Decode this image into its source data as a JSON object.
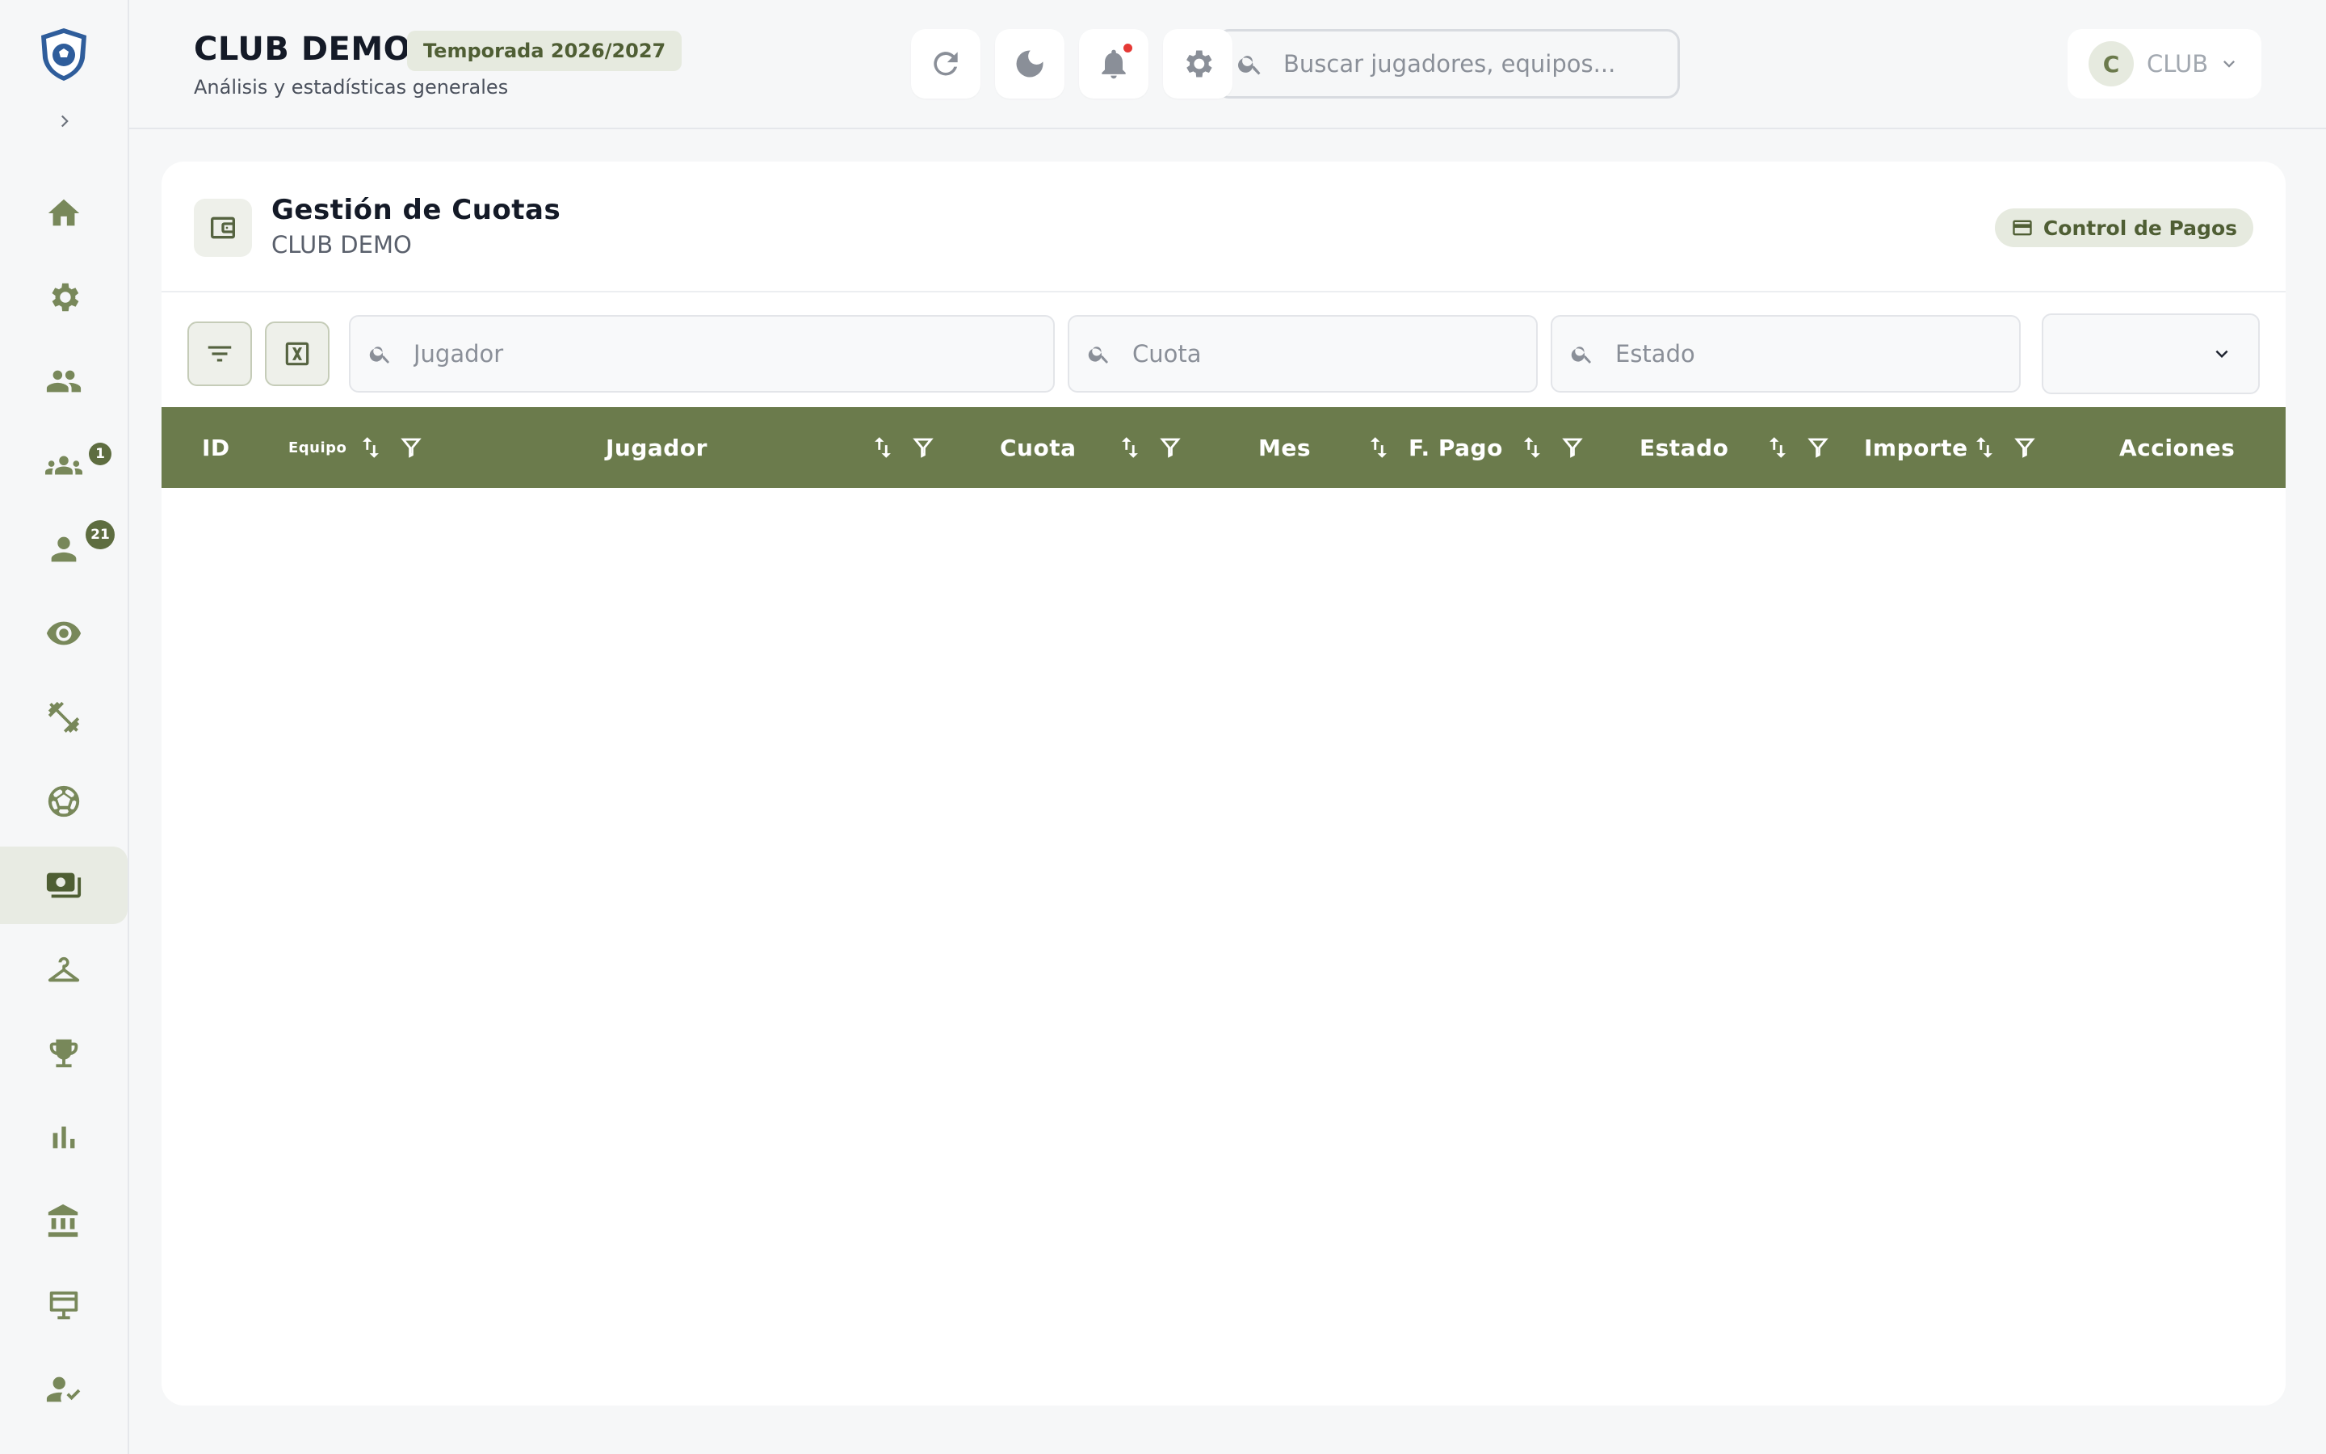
{
  "header": {
    "club_title": "CLUB DEMO",
    "season": "Temporada 2026/2027",
    "subtitle": "Análisis y estadísticas generales",
    "search_placeholder": "Buscar jugadores, equipos...",
    "user_initial": "C",
    "user_name": "CLUB"
  },
  "sidebar": {
    "badges": {
      "teams": "1",
      "players": "21"
    }
  },
  "card": {
    "title": "Gestión de Cuotas",
    "subtitle": "CLUB DEMO",
    "payments_button": "Control de Pagos"
  },
  "filters": {
    "player_placeholder": "Jugador",
    "fee_placeholder": "Cuota",
    "status_placeholder": "Estado",
    "select_value": ""
  },
  "table": {
    "columns": {
      "id": "ID",
      "team": "Equipo",
      "player": "Jugador",
      "fee": "Cuota",
      "month": "Mes",
      "payment_date": "F. Pago",
      "status": "Estado",
      "amount": "Importe",
      "actions": "Acciones"
    }
  },
  "colors": {
    "accent": "#6b7b4c",
    "accent_light": "#e6eadf",
    "notification": "#e53935"
  }
}
